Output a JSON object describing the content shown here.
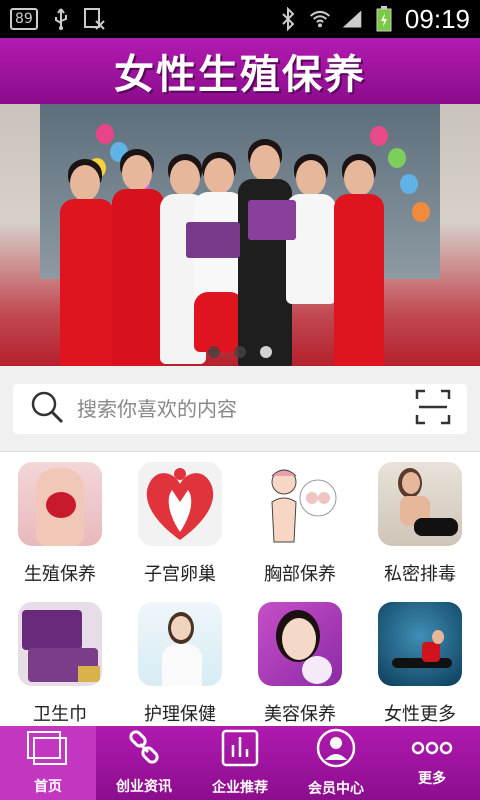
{
  "status_bar": {
    "notification_badge": "89",
    "time": "09:19",
    "icons": [
      "usb-icon",
      "debug-icon",
      "bluetooth-icon",
      "wifi-icon",
      "signal-icon",
      "battery-icon"
    ]
  },
  "header": {
    "title": "女性生殖保养"
  },
  "banner": {
    "page_count": 3,
    "active_index": 2
  },
  "search": {
    "placeholder": "搜索你喜欢的内容"
  },
  "categories": [
    {
      "label": "生殖保养"
    },
    {
      "label": "子宫卵巢"
    },
    {
      "label": "胸部保养"
    },
    {
      "label": "私密排毒"
    },
    {
      "label": "卫生巾"
    },
    {
      "label": "护理保健"
    },
    {
      "label": "美容保养"
    },
    {
      "label": "女性更多"
    }
  ],
  "tab_bar": [
    {
      "label": "首页",
      "icon": "home-icon",
      "active": true
    },
    {
      "label": "创业资讯",
      "icon": "link-icon",
      "active": false
    },
    {
      "label": "企业推荐",
      "icon": "chart-icon",
      "active": false
    },
    {
      "label": "会员中心",
      "icon": "user-icon",
      "active": false
    },
    {
      "label": "更多",
      "icon": "more-icon",
      "active": false
    }
  ],
  "colors": {
    "brand": "#9e12a0",
    "tab_active": "#c236c2"
  }
}
